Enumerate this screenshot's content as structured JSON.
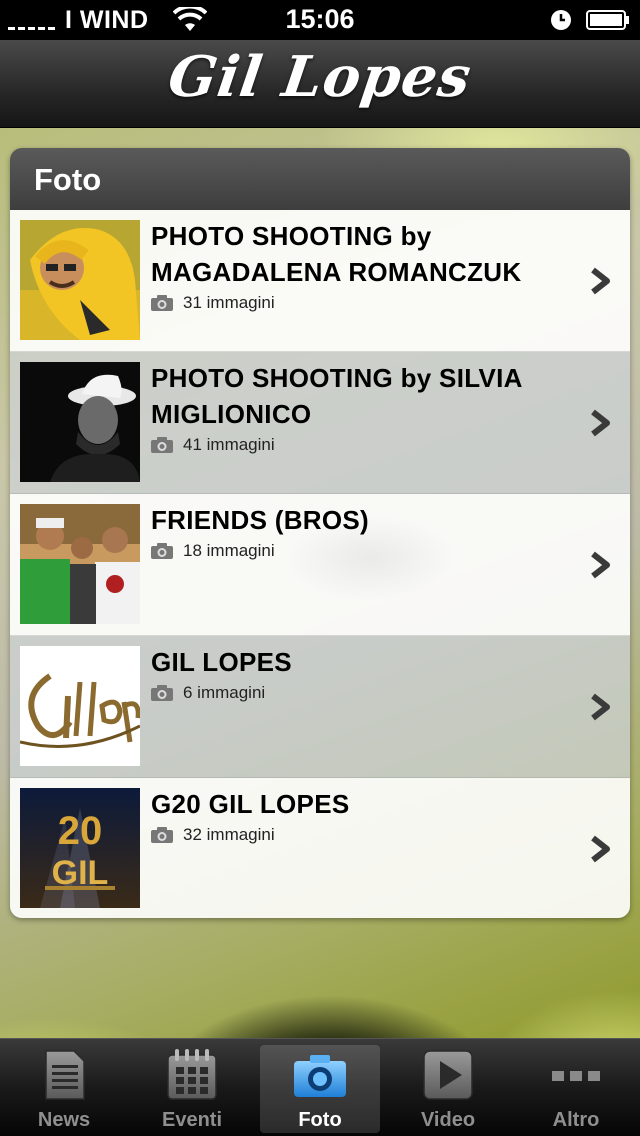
{
  "status_bar": {
    "carrier": "I WIND",
    "time": "15:06"
  },
  "nav": {
    "title": "Gil Lopes"
  },
  "section": {
    "title": "Foto"
  },
  "albums": [
    {
      "title": "PHOTO SHOOTING by MAGADALENA ROMANCZUK",
      "count": "31 immagini"
    },
    {
      "title": "PHOTO SHOOTING by SILVIA MIGLIONICO",
      "count": "41 immagini"
    },
    {
      "title": "FRIENDS (BROS)",
      "count": "18 immagini"
    },
    {
      "title": "GIL LOPES",
      "count": "6 immagini"
    },
    {
      "title": "G20 GIL LOPES",
      "count": "32 immagini",
      "thumb_text_top": "20",
      "thumb_text_bottom": "GIL"
    }
  ],
  "tabs": [
    {
      "label": "News",
      "icon": "news-icon"
    },
    {
      "label": "Eventi",
      "icon": "calendar-icon"
    },
    {
      "label": "Foto",
      "icon": "camera-icon",
      "active": true
    },
    {
      "label": "Video",
      "icon": "play-icon"
    },
    {
      "label": "Altro",
      "icon": "more-icon"
    }
  ],
  "colors": {
    "accent_blue": "#3a9be0",
    "header_dark": "#3e3e3e"
  }
}
